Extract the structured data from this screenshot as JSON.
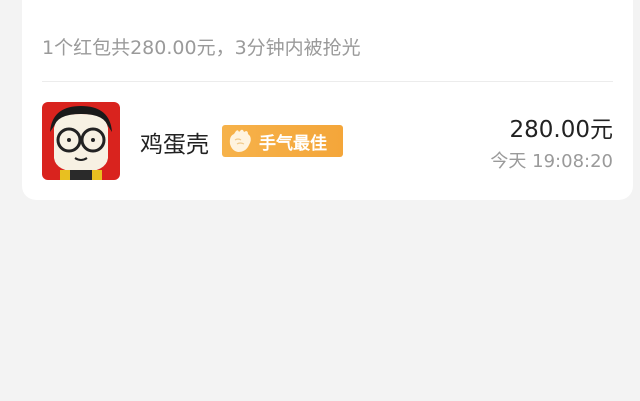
{
  "summary": {
    "text": "1个红包共280.00元，3分钟内被抢光"
  },
  "record": {
    "avatar_icon": "cartoon-glasses-avatar-icon",
    "nickname": "鸡蛋壳",
    "badge_icon": "hand-icon",
    "badge_label": "手气最佳",
    "amount": "280.00元",
    "time": "今天 19:08:20"
  },
  "colors": {
    "page_background": "#f3f3f3",
    "card_background": "#ffffff",
    "badge_background": "#f5ab40",
    "avatar_background": "#d9231e"
  }
}
